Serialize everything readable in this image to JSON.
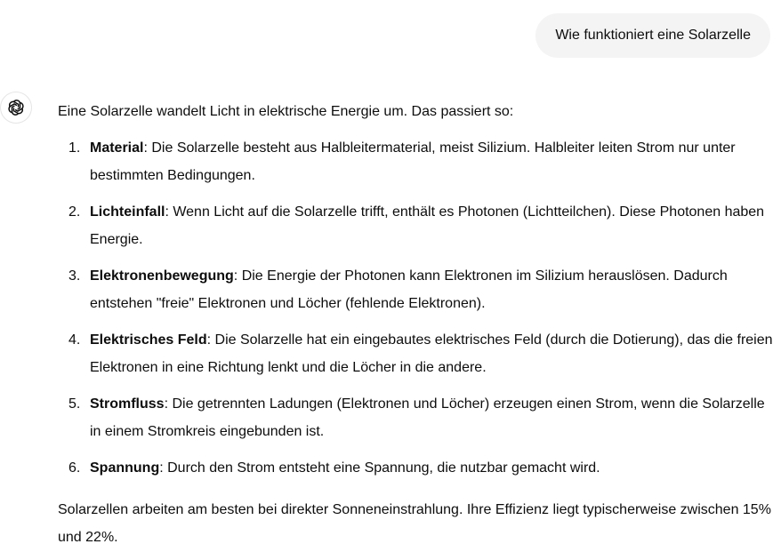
{
  "user_message": "Wie funktioniert eine Solarzelle",
  "assistant": {
    "avatar_icon": "openai-logo-icon",
    "intro": "Eine Solarzelle wandelt Licht in elektrische Energie um. Das passiert so:",
    "steps": [
      {
        "number": "1.",
        "term": "Material",
        "text": ": Die Solarzelle besteht aus Halbleitermaterial, meist Silizium. Halbleiter leiten Strom nur unter bestimmten Bedingungen."
      },
      {
        "number": "2.",
        "term": "Lichteinfall",
        "text": ": Wenn Licht auf die Solarzelle trifft, enthält es Photonen (Lichtteilchen). Diese Photonen haben Energie."
      },
      {
        "number": "3.",
        "term": "Elektronenbewegung",
        "text": ": Die Energie der Photonen kann Elektronen im Silizium herauslösen. Dadurch entstehen \"freie\" Elektronen und Löcher (fehlende Elektronen)."
      },
      {
        "number": "4.",
        "term": "Elektrisches Feld",
        "text": ": Die Solarzelle hat ein eingebautes elektrisches Feld (durch die Dotierung), das die freien Elektronen in eine Richtung lenkt und die Löcher in die andere."
      },
      {
        "number": "5.",
        "term": "Stromfluss",
        "text": ": Die getrennten Ladungen (Elektronen und Löcher) erzeugen einen Strom, wenn die Solarzelle in einem Stromkreis eingebunden ist."
      },
      {
        "number": "6.",
        "term": "Spannung",
        "text": ": Durch den Strom entsteht eine Spannung, die nutzbar gemacht wird."
      }
    ],
    "outro": "Solarzellen arbeiten am besten bei direkter Sonneneinstrahlung. Ihre Effizienz liegt typischerweise zwischen 15% und 22%."
  }
}
